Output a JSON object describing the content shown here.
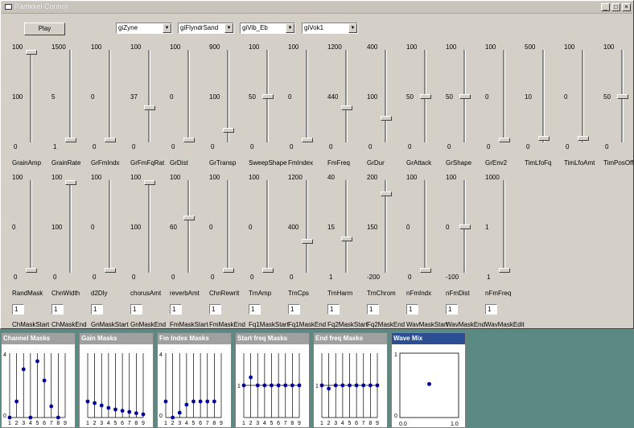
{
  "window": {
    "title": "Partikkel Control"
  },
  "play_label": "Play",
  "combos": [
    {
      "value": "giZyne"
    },
    {
      "value": "giFlyndrSand"
    },
    {
      "value": "giVib_Eb"
    },
    {
      "value": "giVok1"
    }
  ],
  "sliders_row1": [
    {
      "name": "GrainAmp",
      "max": "100",
      "mid": "100",
      "min": "0",
      "level": 1.0
    },
    {
      "name": "GrainRate",
      "max": "1500",
      "mid": "5",
      "min": "1",
      "level": 0.0
    },
    {
      "name": "GrFmIndx",
      "max": "100",
      "mid": "0",
      "min": "0",
      "level": 0.0
    },
    {
      "name": "GrFmFqRat",
      "max": "100",
      "mid": "37",
      "min": "0",
      "level": 0.37
    },
    {
      "name": "GrDist",
      "max": "100",
      "mid": "0",
      "min": "0",
      "level": 0.0
    },
    {
      "name": "GrTransp",
      "max": "900",
      "mid": "100",
      "min": "0",
      "level": 0.11
    },
    {
      "name": "SweepShape",
      "max": "100",
      "mid": "50",
      "min": "0",
      "level": 0.5
    },
    {
      "name": "FmIndex",
      "max": "100",
      "mid": "0",
      "min": "0",
      "level": 0.0
    },
    {
      "name": "FmFreq",
      "max": "1200",
      "mid": "440",
      "min": "0",
      "level": 0.37
    },
    {
      "name": "GrDur",
      "max": "400",
      "mid": "100",
      "min": "0",
      "level": 0.25
    },
    {
      "name": "GrAttack",
      "max": "100",
      "mid": "50",
      "min": "0",
      "level": 0.5
    },
    {
      "name": "GrShape",
      "max": "100",
      "mid": "50",
      "min": "0",
      "level": 0.5
    },
    {
      "name": "GrEnv2",
      "max": "100",
      "mid": "0",
      "min": "0",
      "level": 0.0
    },
    {
      "name": "TimLfoFq",
      "max": "500",
      "mid": "10",
      "min": "0",
      "level": 0.02
    },
    {
      "name": "TimLfoAmt",
      "max": "100",
      "mid": "0",
      "min": "0",
      "level": 0.02
    },
    {
      "name": "TimPosOff",
      "max": "100",
      "mid": "50",
      "min": "0",
      "level": 0.5
    }
  ],
  "sliders_row2": [
    {
      "name": "RandMask",
      "max": "100",
      "mid": "0",
      "min": "0",
      "level": 0.0
    },
    {
      "name": "ChnWidth",
      "max": "100",
      "mid": "100",
      "min": "0",
      "level": 1.0
    },
    {
      "name": "d2Dly",
      "max": "100",
      "mid": "0",
      "min": "0",
      "level": 0.0
    },
    {
      "name": "chorusAmt",
      "max": "100",
      "mid": "100",
      "min": "0",
      "level": 1.0
    },
    {
      "name": "reverbAmt",
      "max": "100",
      "mid": "60",
      "min": "0",
      "level": 0.6
    },
    {
      "name": "ChnRewrit",
      "max": "100",
      "mid": "0",
      "min": "0",
      "level": 0.0
    },
    {
      "name": "TrnAmp",
      "max": "100",
      "mid": "0",
      "min": "0",
      "level": 0.0
    },
    {
      "name": "TrnCps",
      "max": "1200",
      "mid": "400",
      "min": "0",
      "level": 0.33
    },
    {
      "name": "TrnHarm",
      "max": "40",
      "mid": "15",
      "min": "1",
      "level": 0.36
    },
    {
      "name": "TrnChrom",
      "max": "200",
      "mid": "150",
      "min": "-200",
      "level": 0.875
    },
    {
      "name": "nFmIndx",
      "max": "100",
      "mid": "0",
      "min": "0",
      "level": 0.0
    },
    {
      "name": "nFmDist",
      "max": "100",
      "mid": "0",
      "min": "-100",
      "level": 0.5
    },
    {
      "name": "nFmFreq",
      "max": "1000",
      "mid": "1",
      "min": "1",
      "level": 0.0
    }
  ],
  "numboxes": [
    {
      "name": "ChMaskStart",
      "value": "1"
    },
    {
      "name": "ChMaskEnd",
      "value": "1"
    },
    {
      "name": "GnMaskStart",
      "value": "1"
    },
    {
      "name": "GnMaskEnd",
      "value": "1"
    },
    {
      "name": "FmMaskStart",
      "value": "1"
    },
    {
      "name": "FmMaskEnd",
      "value": "1"
    },
    {
      "name": "Fq1MaskStart",
      "value": "1"
    },
    {
      "name": "Fq1MaskEnd",
      "value": "1"
    },
    {
      "name": "Fq2MaskStart",
      "value": "1"
    },
    {
      "name": "Fq2MaskEnd",
      "value": "1"
    },
    {
      "name": "WavMaskStart",
      "value": "1"
    },
    {
      "name": "WavMaskEnd",
      "value": "1"
    },
    {
      "name": "WavMaskEdit",
      "value": "1"
    }
  ],
  "panels": [
    {
      "title": "Channel Masks",
      "ymax": "4",
      "ymin": "0",
      "xticks": [
        "1",
        "2",
        "3",
        "4",
        "5",
        "6",
        "7",
        "8",
        "9"
      ],
      "values": [
        0,
        1,
        3,
        0,
        3.5,
        2.3,
        0.7,
        0,
        null
      ],
      "hline": null
    },
    {
      "title": "Gain Masks",
      "ymax": "",
      "ymin": "",
      "xticks": [
        "1",
        "2",
        "3",
        "4",
        "5",
        "6",
        "7",
        "8",
        "9"
      ],
      "values": [
        1.0,
        0.9,
        0.75,
        0.6,
        0.5,
        0.42,
        0.35,
        0.27,
        0.2
      ],
      "yscale": 4,
      "hline": null
    },
    {
      "title": "Fm Index Masks",
      "ymax": "4",
      "ymin": "0",
      "xticks": [
        "1",
        "2",
        "3",
        "4",
        "5",
        "6",
        "7",
        "8",
        "9"
      ],
      "values": [
        1,
        0,
        0.3,
        0.8,
        1,
        1,
        1,
        1,
        null
      ],
      "hline": null
    },
    {
      "title": "Start freq Masks",
      "ymax": "",
      "ymin": "1",
      "xticks": [
        "1",
        "2",
        "3",
        "4",
        "5",
        "6",
        "7",
        "8",
        "9"
      ],
      "values": [
        1,
        1.25,
        1,
        1,
        1,
        1,
        1,
        1,
        1
      ],
      "yscale": 2,
      "hline": 1
    },
    {
      "title": "End freq Masks",
      "ymax": "",
      "ymin": "1",
      "xticks": [
        "1",
        "2",
        "3",
        "4",
        "5",
        "6",
        "7",
        "8",
        "9"
      ],
      "values": [
        1,
        0.9,
        1,
        1,
        1,
        1,
        1,
        1,
        1
      ],
      "yscale": 2,
      "hline": 1
    },
    {
      "title": "Wave Mix",
      "ymax": "1",
      "ymin": "0",
      "xmin": "0.0",
      "xmax": "1.0",
      "point": [
        0.5,
        0.52
      ]
    }
  ],
  "colors": {
    "point": "#0000a0",
    "window_bg": "#d4d0c8",
    "desktop": "#5b8a82",
    "active_title": "#2c4f93"
  }
}
